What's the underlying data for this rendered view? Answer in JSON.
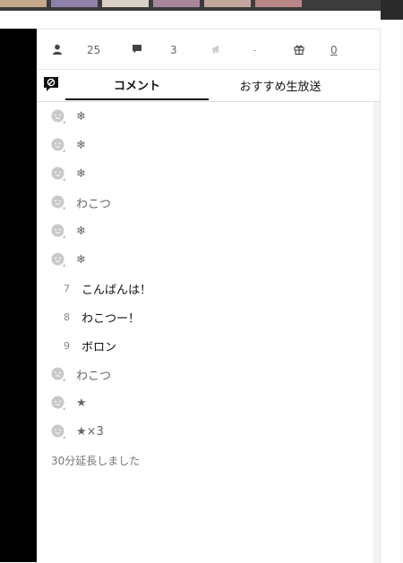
{
  "stats": {
    "viewers": "25",
    "comments": "3",
    "ads": "-",
    "gifts": "0"
  },
  "tabs": {
    "comment_label": "コメント",
    "recommended_label": "おすすめ生放送"
  },
  "comments": [
    {
      "type": "anon",
      "text": "❄"
    },
    {
      "type": "anon",
      "text": "❄"
    },
    {
      "type": "anon",
      "text": "❄"
    },
    {
      "type": "anon",
      "text": "わこつ"
    },
    {
      "type": "anon",
      "text": "❄"
    },
    {
      "type": "anon",
      "text": "❄"
    },
    {
      "type": "numbered",
      "num": "7",
      "text": "こんばんは！"
    },
    {
      "type": "numbered",
      "num": "8",
      "text": "わこつー！"
    },
    {
      "type": "numbered",
      "num": "9",
      "text": "ボロン"
    },
    {
      "type": "anon",
      "text": "わこつ"
    },
    {
      "type": "anon",
      "text": "★"
    },
    {
      "type": "anon",
      "text": "★×3"
    }
  ],
  "notice": "30分延長しました",
  "icons": {
    "viewers": "user-icon",
    "comments": "speech-bubble-icon",
    "ads": "megaphone-icon",
    "gifts": "gift-icon",
    "comment_toggle": "comment-off-icon",
    "avatar": "anonymous-face-icon"
  }
}
